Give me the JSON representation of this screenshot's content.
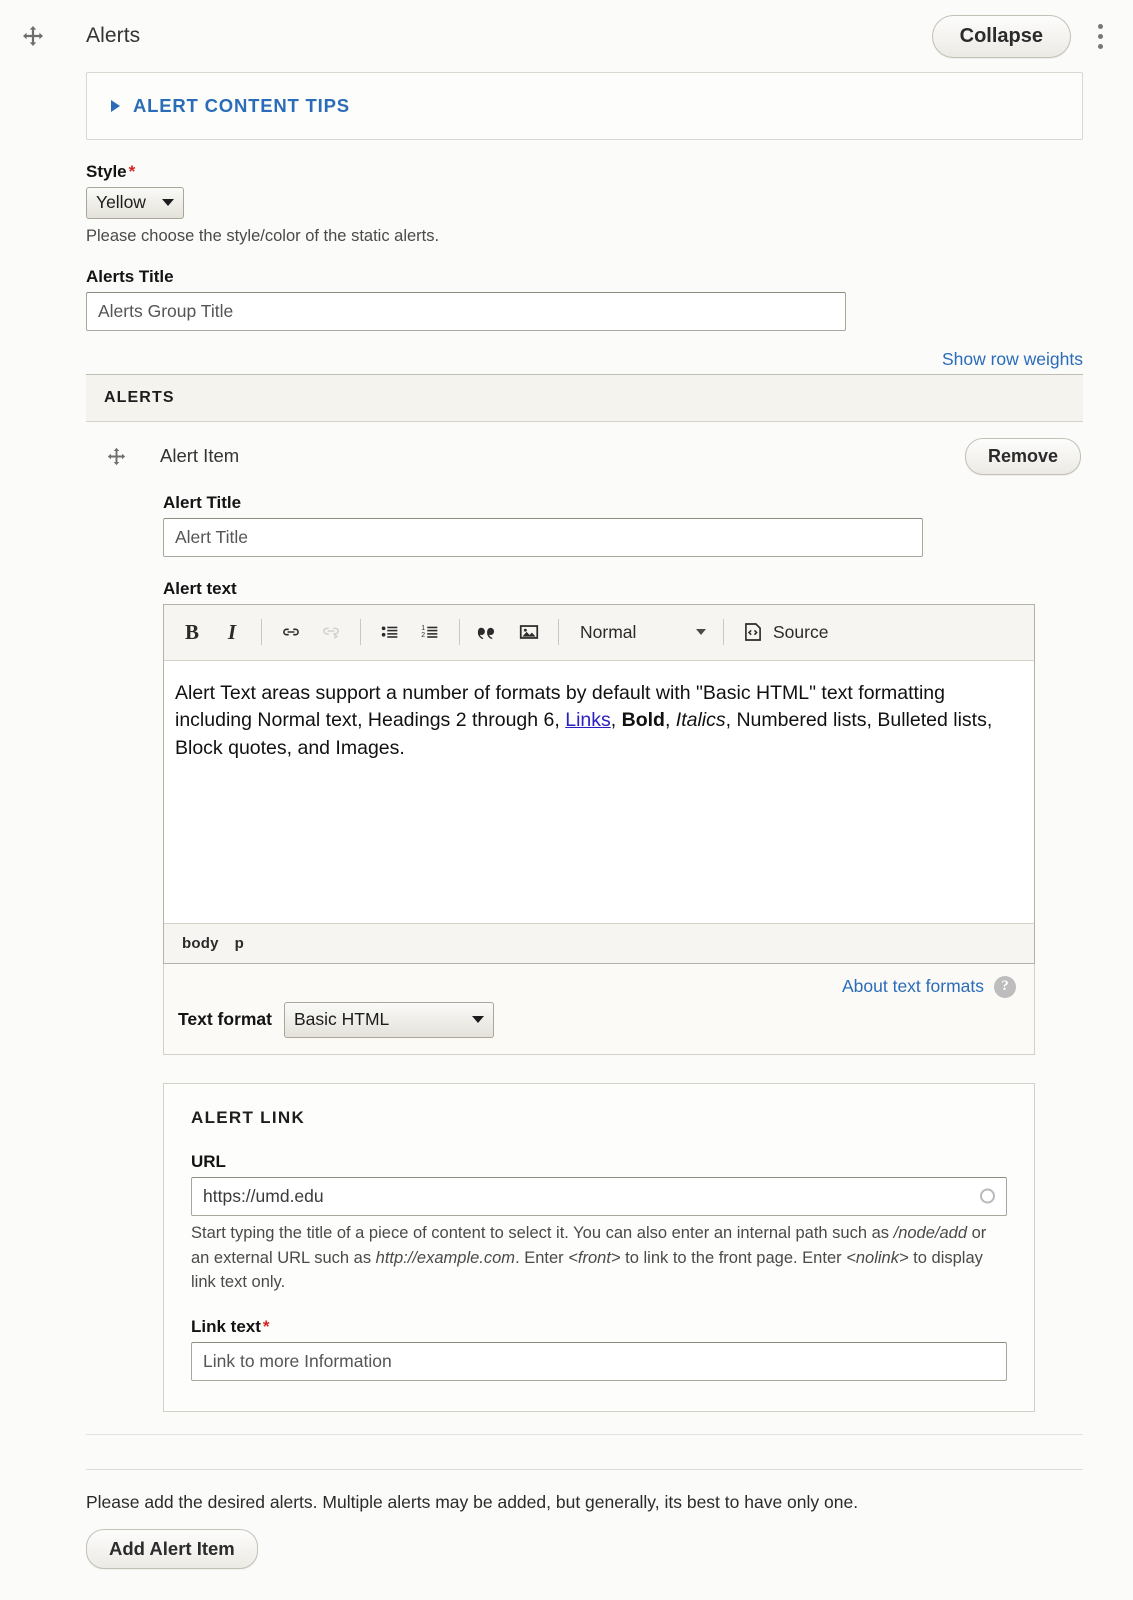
{
  "header": {
    "drag_handle_icon": "move-icon",
    "title": "Alerts",
    "collapse_label": "Collapse",
    "kebab_icon": "vertical-dots-icon"
  },
  "tips": {
    "toggle_icon": "triangle-right-icon",
    "label": "ALERT CONTENT TIPS"
  },
  "style_field": {
    "label": "Style",
    "required_marker": "*",
    "value": "Yellow",
    "description": "Please choose the style/color of the static alerts."
  },
  "alerts_title_field": {
    "label": "Alerts Title",
    "value": "Alerts Group Title",
    "placeholder": "Alerts Group Title"
  },
  "row_weights": {
    "label": "Show row weights"
  },
  "table": {
    "column_header": "ALERTS",
    "rows": [
      {
        "drag_icon": "move-icon",
        "label": "Alert Item",
        "remove_label": "Remove",
        "alert_title": {
          "label": "Alert Title",
          "value": "Alert Title",
          "placeholder": "Alert Title"
        },
        "alert_text": {
          "label": "Alert text",
          "toolbar": {
            "bold": "B",
            "italic": "I",
            "link_icon": "link-icon",
            "unlink_icon": "unlink-icon",
            "bulleted_list_icon": "bulleted-list-icon",
            "numbered_list_icon": "numbered-list-icon",
            "blockquote_icon": "blockquote-icon",
            "image_icon": "image-icon",
            "paragraph_format": "Normal",
            "source_icon": "source-code-icon",
            "source_label": "Source"
          },
          "body_part1": "Alert Text areas support a number of formats by default with \"Basic HTML\" text formatting including Normal text, Headings 2 through 6, ",
          "body_link": "Links",
          "body_part2": ", ",
          "body_bold": "Bold",
          "body_part3": ", ",
          "body_italic": "Italics",
          "body_part4": ", Numbered lists, Bulleted lists, Block quotes, and Images.",
          "elements_path": [
            "body",
            "p"
          ]
        },
        "text_format": {
          "label": "Text format",
          "value": "Basic HTML",
          "about_link": "About text formats",
          "help_icon": "question-mark-icon"
        },
        "alert_link": {
          "legend": "ALERT LINK",
          "url": {
            "label": "URL",
            "value": "https://umd.edu",
            "placeholder": "https://umd.edu",
            "spinner_icon": "autocomplete-spinner-icon",
            "description_part1": "Start typing the title of a piece of content to select it. You can also enter an internal path such as ",
            "description_em1": "/node/add",
            "description_part2": " or an external URL such as ",
            "description_em2": "http://example.com",
            "description_part3": ". Enter ",
            "description_em3": "<front>",
            "description_part4": " to link to the front page. Enter ",
            "description_em4": "<nolink>",
            "description_part5": " to display link text only."
          },
          "link_text": {
            "label": "Link text",
            "required_marker": "*",
            "value": "Link to more Information",
            "placeholder": "Link to more Information"
          }
        }
      }
    ]
  },
  "footer": {
    "note": "Please add the desired alerts. Multiple alerts may be added, but generally, its best to have only one.",
    "add_label": "Add Alert Item"
  },
  "colors": {
    "link": "#2b6cb8",
    "required": "#d72222",
    "editor_link": "#2b1fc0",
    "page_bg": "#fbfbfa"
  }
}
